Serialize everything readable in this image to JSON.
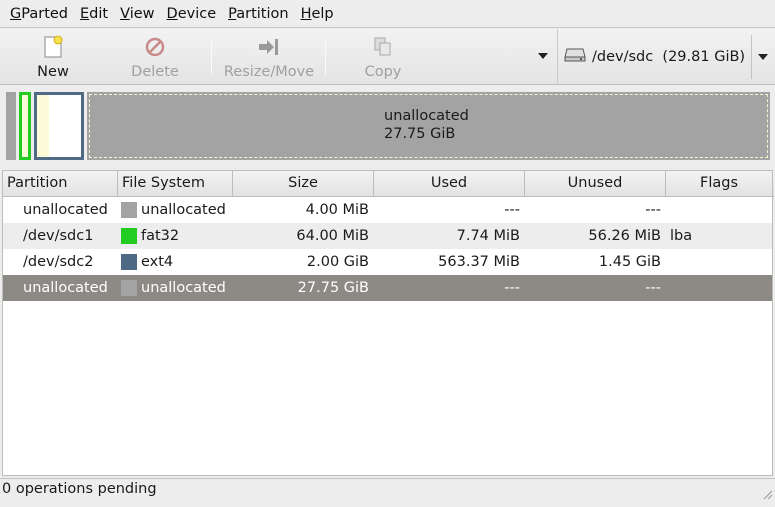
{
  "menubar": {
    "items": [
      {
        "mnemonic": "G",
        "rest": "Parted"
      },
      {
        "mnemonic": "E",
        "rest": "dit"
      },
      {
        "mnemonic": "V",
        "rest": "iew"
      },
      {
        "mnemonic": "D",
        "rest": "evice"
      },
      {
        "mnemonic": "P",
        "rest": "artition"
      },
      {
        "mnemonic": "H",
        "rest": "elp"
      }
    ]
  },
  "toolbar": {
    "new_label": "New",
    "delete_label": "Delete",
    "resize_label": "Resize/Move",
    "copy_label": "Copy"
  },
  "device": {
    "label": "/dev/sdc  (29.81 GiB)"
  },
  "diskmap": {
    "unalloc_label": "unallocated",
    "unalloc_size": "27.75 GiB"
  },
  "table": {
    "headers": [
      "Partition",
      "File System",
      "Size",
      "Used",
      "Unused",
      "Flags"
    ],
    "rows": [
      {
        "partition": "unallocated",
        "fs": "unallocated",
        "fs_color": "#a3a3a3",
        "size": "4.00 MiB",
        "used": "---",
        "unused": "---",
        "flags": ""
      },
      {
        "partition": "/dev/sdc1",
        "fs": "fat32",
        "fs_color": "#22cc22",
        "size": "64.00 MiB",
        "used": "7.74 MiB",
        "unused": "56.26 MiB",
        "flags": "lba"
      },
      {
        "partition": "/dev/sdc2",
        "fs": "ext4",
        "fs_color": "#4f6a84",
        "size": "2.00 GiB",
        "used": "563.37 MiB",
        "unused": "1.45 GiB",
        "flags": ""
      },
      {
        "partition": "unallocated",
        "fs": "unallocated",
        "fs_color": "#a3a3a3",
        "size": "27.75 GiB",
        "used": "---",
        "unused": "---",
        "flags": ""
      }
    ],
    "selected_row": 3
  },
  "status": {
    "text": "0 operations pending"
  }
}
